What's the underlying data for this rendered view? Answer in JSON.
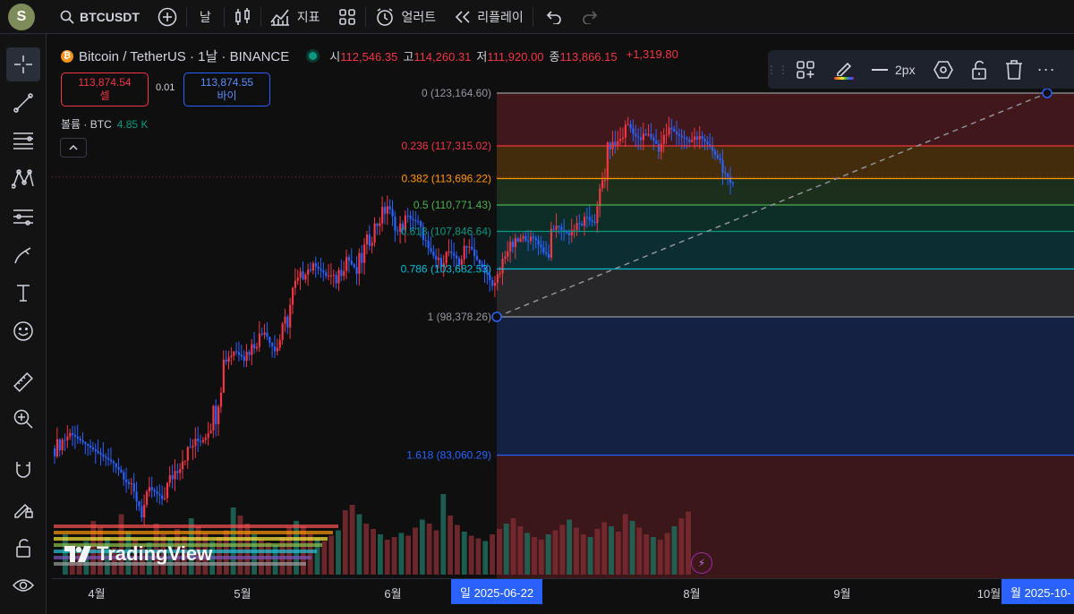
{
  "topbar": {
    "avatar_letter": "S",
    "symbol": "BTCUSDT",
    "interval": "날",
    "indicators_label": "지표",
    "alert_label": "얼러트",
    "replay_label": "리플레이"
  },
  "legend": {
    "title": "Bitcoin / TetherUS · 1날 · BINANCE",
    "coin_glyph": "₿",
    "open_label": "시",
    "open": "112,546.35",
    "high_label": "고",
    "high": "114,260.31",
    "low_label": "저",
    "low": "111,920.00",
    "close_label": "종",
    "close": "113,866.15",
    "change": "+1,319.80"
  },
  "order": {
    "sell_price": "113,874.54",
    "sell_label": "셀",
    "spread": "0.01",
    "buy_price": "113,874.55",
    "buy_label": "바이"
  },
  "volume_legend": {
    "label": "볼륨 · BTC",
    "value": "4.85 K"
  },
  "draw_toolbar": {
    "width_label": "2px"
  },
  "watermark": "TradingView",
  "time_axis": {
    "ticks": [
      "4월",
      "5월",
      "6월",
      "8월",
      "9월",
      "10월"
    ],
    "tag_start": "일 2025-06-22",
    "tag_end": "월 2025-10-"
  },
  "colors": {
    "up": "#f23645",
    "down": "#2962ff",
    "vol_up": "#7c2b33",
    "vol_down": "#1e6b5c"
  },
  "chart_data": {
    "type": "candlestick",
    "fib_levels": [
      {
        "ratio": "0",
        "price": 123164.6,
        "label": "0 (123,164.60)",
        "color": "#9598a1"
      },
      {
        "ratio": "0.236",
        "price": 117315.02,
        "label": "0.236 (117,315.02)",
        "color": "#f23645"
      },
      {
        "ratio": "0.382",
        "price": 113696.22,
        "label": "0.382 (113,696.22)",
        "color": "#ff9800"
      },
      {
        "ratio": "0.5",
        "price": 110771.43,
        "label": "0.5 (110,771.43)",
        "color": "#4caf50"
      },
      {
        "ratio": "0.618",
        "price": 107846.64,
        "label": "0.618 (107,846.64)",
        "color": "#089981"
      },
      {
        "ratio": "0.786",
        "price": 103682.53,
        "label": "0.786 (103,682.53)",
        "color": "#00bcd4"
      },
      {
        "ratio": "1",
        "price": 98378.26,
        "label": "1 (98,378.26)",
        "color": "#9598a1"
      },
      {
        "ratio": "1.618",
        "price": 83060.29,
        "label": "1.618 (83,060.29)",
        "color": "#2962ff"
      }
    ],
    "close_series": [
      [
        0,
        83800
      ],
      [
        6,
        85500
      ],
      [
        12,
        84300
      ],
      [
        18,
        83100
      ],
      [
        24,
        82000
      ],
      [
        30,
        79500
      ],
      [
        34,
        76800
      ],
      [
        38,
        79200
      ],
      [
        42,
        78300
      ],
      [
        46,
        80800
      ],
      [
        50,
        82700
      ],
      [
        54,
        84200
      ],
      [
        58,
        85100
      ],
      [
        62,
        87100
      ],
      [
        66,
        93500
      ],
      [
        70,
        94600
      ],
      [
        74,
        94000
      ],
      [
        78,
        95400
      ],
      [
        82,
        96900
      ],
      [
        86,
        94600
      ],
      [
        90,
        97300
      ],
      [
        94,
        101900
      ],
      [
        98,
        103500
      ],
      [
        102,
        104000
      ],
      [
        106,
        103000
      ],
      [
        110,
        102700
      ],
      [
        114,
        105000
      ],
      [
        118,
        103400
      ],
      [
        122,
        106500
      ],
      [
        126,
        108800
      ],
      [
        130,
        110700
      ],
      [
        134,
        107700
      ],
      [
        138,
        109500
      ],
      [
        142,
        108700
      ],
      [
        146,
        105900
      ],
      [
        150,
        104300
      ],
      [
        154,
        105600
      ],
      [
        158,
        104600
      ],
      [
        162,
        106400
      ],
      [
        166,
        104200
      ],
      [
        170,
        102600
      ],
      [
        172,
        100900
      ],
      [
        176,
        105500
      ],
      [
        180,
        106600
      ],
      [
        184,
        107100
      ],
      [
        188,
        106900
      ],
      [
        192,
        105200
      ],
      [
        196,
        108500
      ],
      [
        200,
        107600
      ],
      [
        204,
        108300
      ],
      [
        208,
        109200
      ],
      [
        212,
        108800
      ],
      [
        216,
        117200
      ],
      [
        220,
        117600
      ],
      [
        224,
        119700
      ],
      [
        228,
        117900
      ],
      [
        232,
        118600
      ],
      [
        236,
        117200
      ],
      [
        240,
        119300
      ],
      [
        244,
        118500
      ],
      [
        248,
        117700
      ],
      [
        252,
        118400
      ],
      [
        256,
        117200
      ],
      [
        260,
        115600
      ],
      [
        264,
        112600
      ],
      [
        266,
        113866
      ]
    ],
    "volume": [
      30,
      22,
      18,
      25,
      40,
      35,
      28,
      20,
      45,
      32,
      26,
      22,
      24,
      38,
      30,
      27,
      34,
      29,
      42,
      36,
      31,
      25,
      28,
      33,
      50,
      44,
      38,
      30,
      26,
      24,
      22,
      28,
      35,
      40,
      36,
      30,
      27,
      25,
      29,
      33,
      48,
      52,
      45,
      38,
      34,
      30,
      26,
      28,
      31,
      29,
      35,
      41,
      38,
      33,
      60,
      44,
      37,
      32,
      29,
      27,
      25,
      30,
      34,
      38,
      42,
      36,
      31,
      28,
      26,
      30,
      33,
      37,
      41,
      35,
      30,
      28,
      34,
      39,
      36,
      32,
      45,
      40,
      35,
      30,
      28,
      26,
      31,
      36,
      42,
      47
    ]
  }
}
